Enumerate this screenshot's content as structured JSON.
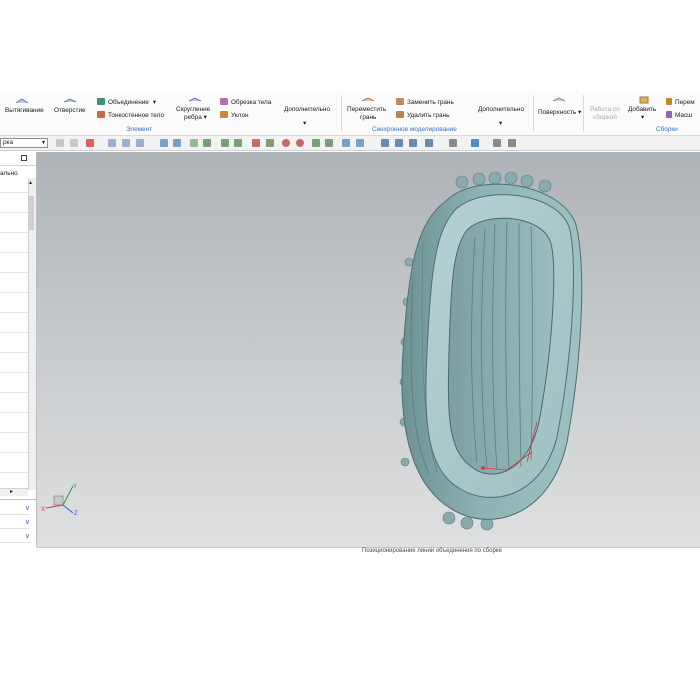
{
  "ribbon": {
    "extrude_label": "Вытягивание",
    "hole_label": "Отверстие",
    "unite_label": "Объединение",
    "thin_body_label": "Тонкостенное тело",
    "edge_round_label_1": "Скругление",
    "edge_round_label_2": "ребра",
    "trim_body_label": "Обрезка тела",
    "draft_label": "Уклон",
    "more_label": "Дополнительно",
    "element_group_label": "Элемент",
    "move_face_label_1": "Переместить",
    "move_face_label_2": "грань",
    "replace_face_label": "Заменить грань",
    "delete_face_label": "Удалить грань",
    "more2_label": "Дополнительно",
    "sync_group_label": "Синхронное моделирование",
    "surface_label": "Поверхность",
    "work_assembly_label_1": "Работа со",
    "work_assembly_label_2": "сборкой",
    "add_label": "Добавить",
    "move_partial_label": "Перем",
    "scale_partial_label": "Масш",
    "assemblies_group_label": "Сборки"
  },
  "toolbar": {
    "filter_value": "рка"
  },
  "panel": {
    "header_text": "ально"
  },
  "status": {
    "hint_text": "Позиционирование линии объединения по сборке"
  },
  "colors": {
    "accent": "#3a6fb8",
    "viewport_top": "#aeb3b7",
    "viewport_bottom": "#dfe0e1",
    "model": "#7fa6a8"
  },
  "icons": [
    "extrude-icon",
    "hole-icon",
    "unite-icon",
    "thin-body-icon",
    "edge-round-icon",
    "trim-body-icon",
    "draft-icon",
    "move-face-icon",
    "replace-face-icon",
    "delete-face-icon",
    "surface-icon",
    "add-icon",
    "triad-icon"
  ]
}
